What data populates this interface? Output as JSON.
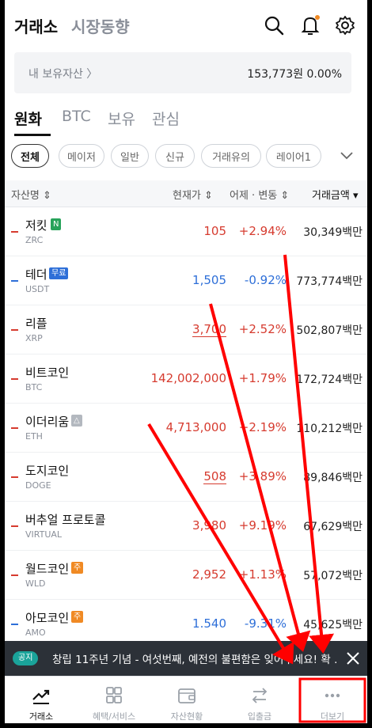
{
  "header": {
    "title": "거래소",
    "subtitle": "시장동향"
  },
  "asset": {
    "label": "내 보유자산 〉",
    "value": "153,773원 0.00%"
  },
  "tabs": [
    "원화",
    "BTC",
    "보유",
    "관심"
  ],
  "chips": [
    "전체",
    "메이저",
    "일반",
    "신규",
    "거래유의",
    "레이어1"
  ],
  "columns": {
    "name": "자산명 ⇕",
    "price": "현재가 ⇕",
    "change": "어제 · 변동 ⇕",
    "volume": "거래금액 ▾"
  },
  "rows": [
    {
      "name": "저킷",
      "badge": "N",
      "badge_color": "#27a35a",
      "symbol": "ZRC",
      "price": "105",
      "change": "+2.94%",
      "volume": "30,349백만",
      "dir": "up"
    },
    {
      "name": "테더",
      "badge": "무료",
      "badge_color": "#2e6fd8",
      "symbol": "USDT",
      "price": "1,505",
      "change": "-0.92%",
      "volume": "773,774백만",
      "dir": "down"
    },
    {
      "name": "리플",
      "badge": "",
      "symbol": "XRP",
      "price": "3,700",
      "change": "+2.52%",
      "volume": "502,807백만",
      "dir": "up"
    },
    {
      "name": "비트코인",
      "badge": "",
      "symbol": "BTC",
      "price": "142,002,000",
      "change": "+1.79%",
      "volume": "172,724백만",
      "dir": "up"
    },
    {
      "name": "이더리움",
      "badge": "△",
      "badge_color": "#b3b8bf",
      "symbol": "ETH",
      "price": "4,713,000",
      "change": "+2.19%",
      "volume": "110,212백만",
      "dir": "up"
    },
    {
      "name": "도지코인",
      "badge": "",
      "symbol": "DOGE",
      "price": "508",
      "change": "+3.89%",
      "volume": "89,846백만",
      "dir": "up"
    },
    {
      "name": "버추얼 프로토콜",
      "badge": "",
      "symbol": "VIRTUAL",
      "price": "3,980",
      "change": "+9.19%",
      "volume": "67,629백만",
      "dir": "up"
    },
    {
      "name": "월드코인",
      "badge": "주",
      "badge_color": "#f08a24",
      "symbol": "WLD",
      "price": "2,952",
      "change": "+1.13%",
      "volume": "57,072백만",
      "dir": "up"
    },
    {
      "name": "아모코인",
      "badge": "주",
      "badge_color": "#f08a24",
      "symbol": "AMO",
      "price": "1.540",
      "change": "-9.31%",
      "volume": "45,625백만",
      "dir": "down"
    }
  ],
  "notice": {
    "pill": "공지",
    "text": "창립 11주년 기념 - 여섯번째, 예전의 불편함은 잊어주세요! 확 …"
  },
  "nav": [
    "거래소",
    "혜택/서비스",
    "자산현황",
    "입출금",
    "더보기"
  ],
  "colors": {
    "up": "#d63b2f",
    "down": "#2e6fd8",
    "annotation": "#ff0000"
  }
}
